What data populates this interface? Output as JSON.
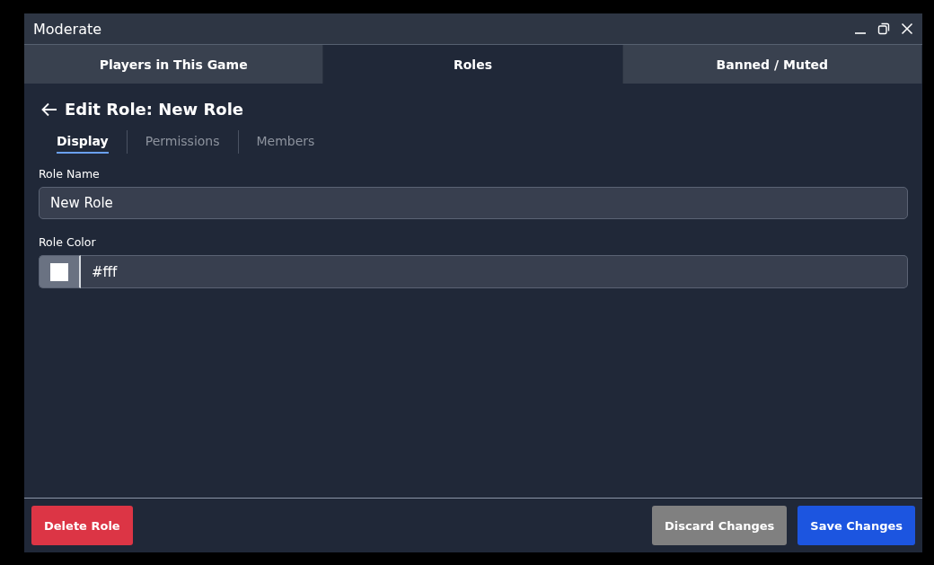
{
  "window": {
    "title": "Moderate"
  },
  "tabs": [
    {
      "label": "Players in This Game",
      "selected": false
    },
    {
      "label": "Roles",
      "selected": true
    },
    {
      "label": "Banned / Muted",
      "selected": false
    }
  ],
  "heading": "Edit Role: New Role",
  "subtabs": [
    {
      "label": "Display",
      "selected": true
    },
    {
      "label": "Permissions",
      "selected": false
    },
    {
      "label": "Members",
      "selected": false
    }
  ],
  "role_name": {
    "label": "Role Name",
    "value": "New Role"
  },
  "role_color": {
    "label": "Role Color",
    "value": "#fff",
    "color": "#ffffff"
  },
  "buttons": [
    {
      "label": "Delete Role",
      "kind": "danger"
    },
    {
      "label": "Discard Changes",
      "kind": "secondary"
    },
    {
      "label": "Save Changes",
      "kind": "primary"
    }
  ]
}
